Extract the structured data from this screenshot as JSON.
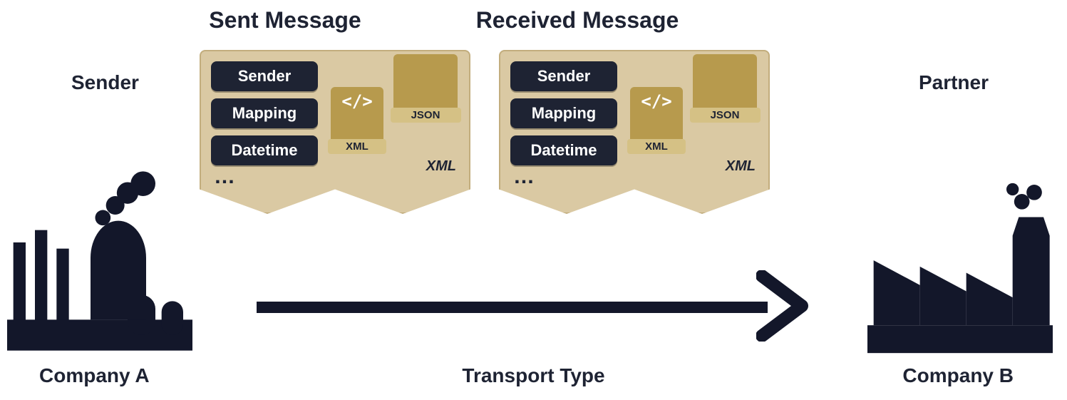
{
  "messages": {
    "sent": {
      "title": "Sent Message",
      "fields": [
        "Sender",
        "Mapping",
        "Datetime"
      ],
      "more": "…",
      "files": {
        "xml_glyph": "</>",
        "xml_label": "XML",
        "json_label": "JSON"
      },
      "format_hint": "XML"
    },
    "received": {
      "title": "Received Message",
      "fields": [
        "Sender",
        "Mapping",
        "Datetime"
      ],
      "more": "…",
      "files": {
        "xml_glyph": "</>",
        "xml_label": "XML",
        "json_label": "JSON"
      },
      "format_hint": "XML"
    }
  },
  "left": {
    "role": "Sender",
    "company": "Company A"
  },
  "right": {
    "role": "Partner",
    "company": "Company B"
  },
  "transport": {
    "label": "Transport Type"
  },
  "colors": {
    "navy": "#1e2333",
    "tan": "#dac9a3",
    "gold": "#b79a4d"
  }
}
